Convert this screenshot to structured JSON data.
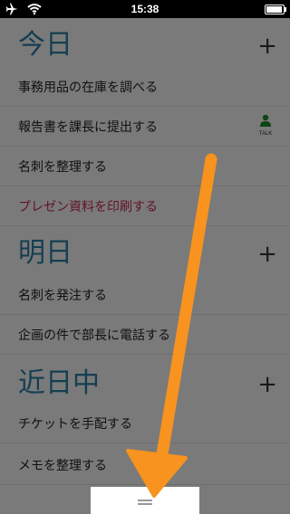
{
  "status": {
    "time": "15:38",
    "icons": [
      "airplane-icon",
      "wifi-icon",
      "battery-icon"
    ],
    "battery_level": 0.95
  },
  "sections": [
    {
      "title": "今日",
      "items": [
        {
          "label": "事務用品の在庫を調べる"
        },
        {
          "label": "報告書を課長に提出する",
          "talk_label": "TALK"
        },
        {
          "label": "名刺を整理する"
        },
        {
          "label": "プレゼン資料を印刷する",
          "highlight": true
        }
      ]
    },
    {
      "title": "明日",
      "items": [
        {
          "label": "名刺を発注する"
        },
        {
          "label": "企画の件で部長に電話する"
        }
      ]
    },
    {
      "title": "近日中",
      "items": [
        {
          "label": "チケットを手配する"
        },
        {
          "label": "メモを整理する"
        }
      ]
    }
  ],
  "add_symbol": "+",
  "colors": {
    "section_title": "#2b7da3",
    "highlight_text": "#c0294f",
    "talk_icon": "#1a8a2a",
    "arrow": "#f7931e"
  }
}
